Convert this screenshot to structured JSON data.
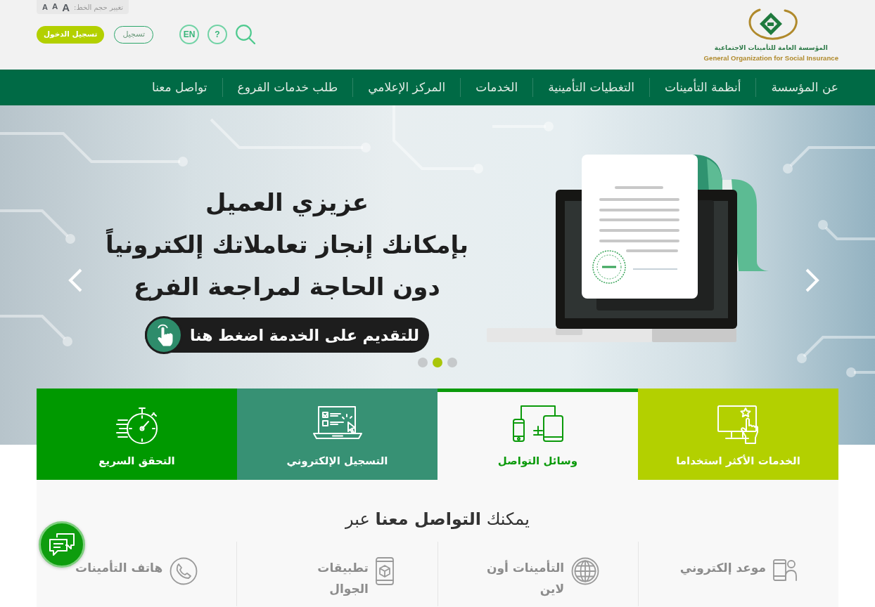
{
  "header": {
    "font_size_label": "تغيير حجم الخط:",
    "font_sizes": [
      "A",
      "A",
      "A"
    ],
    "login_button": "تسجيل الدخول",
    "register_button": "تسجيل",
    "language_button": "EN",
    "help_button": "?",
    "logo": {
      "arabic": "المؤسسة العامة للتأمينات الاجتماعية",
      "english": "General Organization for Social Insurance"
    }
  },
  "nav": {
    "items": [
      "عن المؤسسة",
      "أنظمة التأمينات",
      "التغطيات التأمينية",
      "الخدمات",
      "المركز الإعلامي",
      "طلب خدمات الفروع",
      "تواصل معنا"
    ]
  },
  "hero": {
    "lines": [
      "عزيزي العميل",
      "بإمكانك إنجاز تعاملاتك إلكترونياً",
      "دون الحاجة لمراجعة الفرع"
    ],
    "cta": "للتقديم على الخدمة اضغط هنا",
    "slides": [
      {
        "selected": false
      },
      {
        "selected": true
      },
      {
        "selected": false
      }
    ]
  },
  "tiles": [
    {
      "label": "الخدمات الأكثر استخداما",
      "color": "#b3d000",
      "selected": false
    },
    {
      "label": "وسائل التواصل",
      "color": "#0b9a0b",
      "selected": true
    },
    {
      "label": "التسجيل الإلكتروني",
      "color": "#379174",
      "selected": false
    },
    {
      "label": "التحقق السريع",
      "color": "#009900",
      "selected": false
    }
  ],
  "contact": {
    "title": "يمكنك **التواصل معنا** عبر",
    "channels": [
      "موعد إلكتروني",
      "التأمينات أون لاين",
      "تطبيقات الجوال",
      "هاتف التأمينات"
    ]
  }
}
